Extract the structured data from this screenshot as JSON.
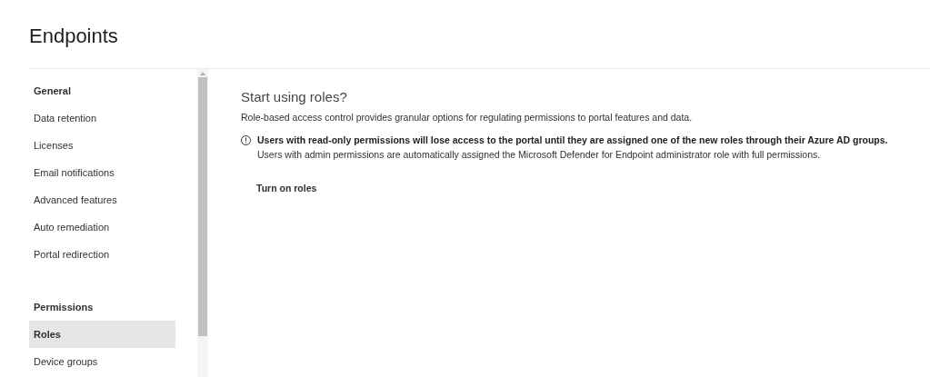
{
  "page": {
    "title": "Endpoints"
  },
  "sidebar": {
    "sections": [
      {
        "heading": "General",
        "items": [
          {
            "label": "Data retention",
            "selected": false
          },
          {
            "label": "Licenses",
            "selected": false
          },
          {
            "label": "Email notifications",
            "selected": false
          },
          {
            "label": "Advanced features",
            "selected": false
          },
          {
            "label": "Auto remediation",
            "selected": false
          },
          {
            "label": "Portal redirection",
            "selected": false
          }
        ]
      },
      {
        "heading": "Permissions",
        "items": [
          {
            "label": "Roles",
            "selected": true
          },
          {
            "label": "Device groups",
            "selected": false
          }
        ]
      }
    ]
  },
  "content": {
    "heading": "Start using roles?",
    "description": "Role-based access control provides granular options for regulating permissions to portal features and data.",
    "warning": {
      "title": "Users with read-only permissions will lose access to the portal until they are assigned one of the new roles through their Azure AD groups.",
      "detail": "Users with admin permissions are automatically assigned the Microsoft Defender for Endpoint administrator role with full permissions."
    },
    "button": "Turn on roles"
  }
}
